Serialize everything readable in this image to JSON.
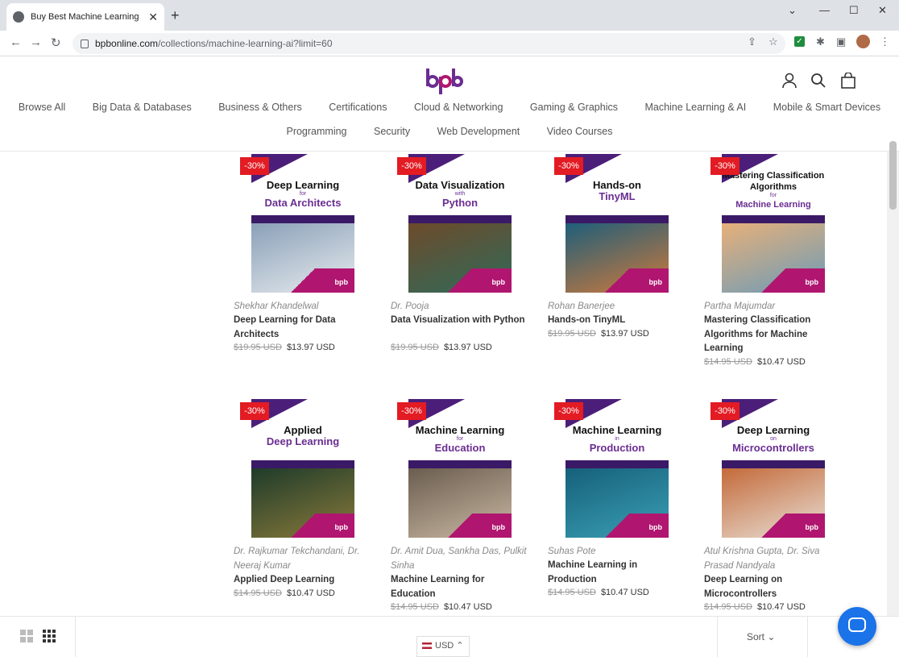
{
  "browser": {
    "tab_title": "Buy Best Machine Learning & AI",
    "url_host": "bpbonline.com",
    "url_path": "/collections/machine-learning-ai?limit=60",
    "new_tab": "+",
    "tab_close": "✕"
  },
  "header": {
    "logo_text": "bpb",
    "nav_row1": [
      "Browse All",
      "Big Data & Databases",
      "Business & Others",
      "Certifications",
      "Cloud & Networking",
      "Gaming & Graphics",
      "Machine Learning & AI",
      "Mobile & Smart Devices"
    ],
    "nav_row2": [
      "Programming",
      "Security",
      "Web Development",
      "Video Courses"
    ]
  },
  "products": [
    {
      "badge": "-30%",
      "cover_title": "Deep Learning",
      "cover_sub": "for",
      "cover_title2": "Data Architects",
      "author": "Shekhar Khandelwal",
      "title": "Deep Learning for Data Architects",
      "old_price": "$19.95 USD",
      "new_price": "$13.97 USD"
    },
    {
      "badge": "-30%",
      "cover_title": "Data Visualization",
      "cover_sub": "with",
      "cover_title2": "Python",
      "author": "Dr. Pooja",
      "title": "Data Visualization with Python",
      "old_price": "$19.95 USD",
      "new_price": "$13.97 USD"
    },
    {
      "badge": "-30%",
      "cover_title": "Hands-on",
      "cover_sub": "",
      "cover_title2": "TinyML",
      "author": "Rohan Banerjee",
      "title": "Hands-on TinyML",
      "old_price": "$19.95 USD",
      "new_price": "$13.97 USD"
    },
    {
      "badge": "-30%",
      "cover_title": "Mastering Classification Algorithms",
      "cover_sub": "for",
      "cover_title2": "Machine Learning",
      "author": "Partha Majumdar",
      "title": "Mastering Classification Algorithms for Machine Learning",
      "old_price": "$14.95 USD",
      "new_price": "$10.47 USD"
    },
    {
      "badge": "-30%",
      "cover_title": "Applied",
      "cover_sub": "",
      "cover_title2": "Deep Learning",
      "author": "Dr. Rajkumar Tekchandani, Dr. Neeraj Kumar",
      "title": "Applied Deep Learning",
      "old_price": "$14.95 USD",
      "new_price": "$10.47 USD"
    },
    {
      "badge": "-30%",
      "cover_title": "Machine Learning",
      "cover_sub": "for",
      "cover_title2": "Education",
      "author": "Dr. Amit Dua, Sankha Das, Pulkit Sinha",
      "title": "Machine Learning for Education",
      "old_price": "$14.95 USD",
      "new_price": "$10.47 USD"
    },
    {
      "badge": "-30%",
      "cover_title": "Machine Learning",
      "cover_sub": "in",
      "cover_title2": "Production",
      "author": "Suhas Pote",
      "title": "Machine Learning in Production",
      "old_price": "$14.95 USD",
      "new_price": "$10.47 USD"
    },
    {
      "badge": "-30%",
      "cover_title": "Deep Learning",
      "cover_sub": "on",
      "cover_title2": "Microcontrollers",
      "author": "Atul Krishna Gupta, Dr. Siva Prasad Nandyala",
      "title": "Deep Learning on Microcontrollers",
      "old_price": "$14.95 USD",
      "new_price": "$10.47 USD"
    }
  ],
  "footer_bar": {
    "sort_label": "Sort",
    "currency": "USD"
  },
  "colors": {
    "badge": "#e31b23",
    "brand_purple": "#4b1f79",
    "brand_pink": "#b0166f",
    "chat_blue": "#1a73e8"
  }
}
